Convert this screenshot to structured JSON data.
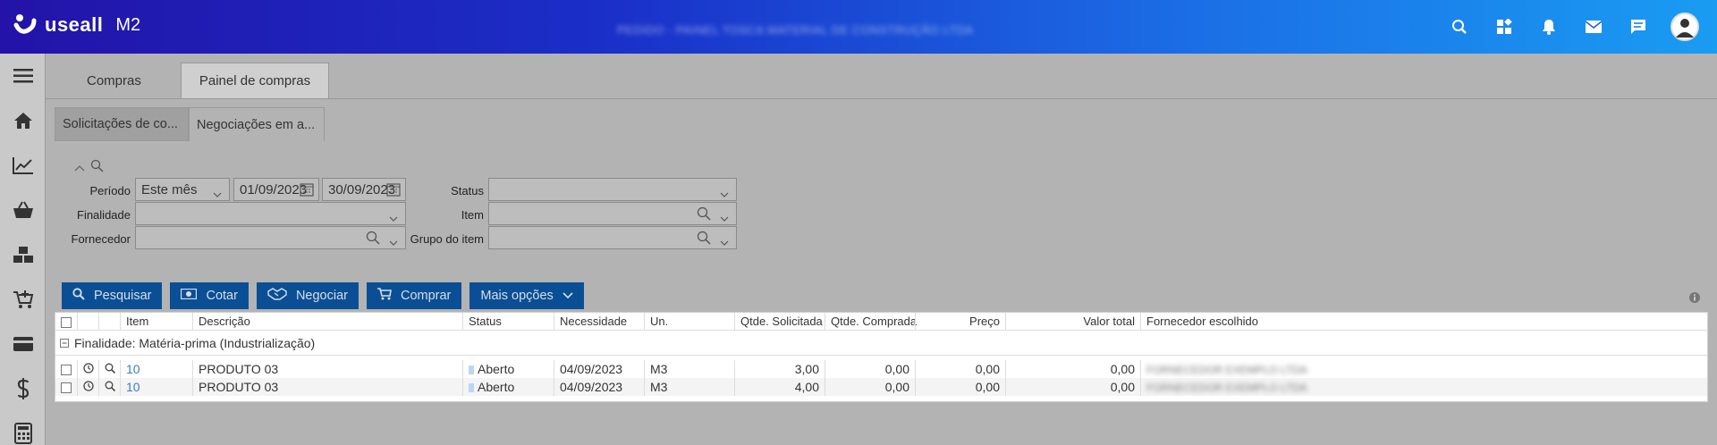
{
  "header": {
    "logo_text": "useall",
    "logo_suffix": "M2",
    "doc_title": "PEDIDO - PAINEL TOSCA MATERIAL DE CONSTRUÇÃO LTDA"
  },
  "colors": {
    "accent": "#0a4f95",
    "link": "#3b7dc4",
    "status_aberto": "#b9d7f2"
  },
  "main_tabs": [
    {
      "label": "Compras"
    },
    {
      "label": "Painel de compras"
    }
  ],
  "sub_tabs": [
    {
      "label": "Solicitações de co..."
    },
    {
      "label": "Negociações em a..."
    }
  ],
  "filters": {
    "periodo_label": "Período",
    "periodo_value": "Este mês",
    "date_from": "01/09/2023",
    "date_to": "30/09/2023",
    "finalidade_label": "Finalidade",
    "finalidade_value": "",
    "fornecedor_label": "Fornecedor",
    "fornecedor_value": "",
    "status_label": "Status",
    "status_value": "",
    "item_label": "Item",
    "item_value": "",
    "grupo_label": "Grupo do item",
    "grupo_value": ""
  },
  "buttons": {
    "pesquisar": "Pesquisar",
    "cotar": "Cotar",
    "negociar": "Negociar",
    "comprar": "Comprar",
    "mais_opcoes": "Mais opções"
  },
  "grid": {
    "columns": [
      "Item",
      "Descrição",
      "Status",
      "Necessidade",
      "Un.",
      "Qtde. Solicitada",
      "Qtde. Comprada",
      "Preço",
      "Valor total",
      "Fornecedor escolhido"
    ],
    "group_label": "Finalidade: Matéria-prima (Industrialização)",
    "rows": [
      {
        "item": "10",
        "descricao": "PRODUTO 03",
        "status": "Aberto",
        "necessidade": "04/09/2023",
        "un": "M3",
        "qtde_solicitada": "3,00",
        "qtde_comprada": "0,00",
        "preco": "0,00",
        "valor_total": "0,00",
        "fornecedor": "FORNECEDOR EXEMPLO LTDA"
      },
      {
        "item": "10",
        "descricao": "PRODUTO 03",
        "status": "Aberto",
        "necessidade": "04/09/2023",
        "un": "M3",
        "qtde_solicitada": "4,00",
        "qtde_comprada": "0,00",
        "preco": "0,00",
        "valor_total": "0,00",
        "fornecedor": "FORNECEDOR EXEMPLO LTDA"
      }
    ]
  },
  "icons": {
    "top": [
      "search-icon",
      "apps-icon",
      "bell-icon",
      "mail-icon",
      "chat-icon",
      "avatar"
    ],
    "sidebar": [
      "menu-icon",
      "home-icon",
      "chart-icon",
      "basket-icon",
      "boxes-icon",
      "cart-add-icon",
      "card-icon",
      "dollar-icon",
      "calculator-icon"
    ]
  }
}
